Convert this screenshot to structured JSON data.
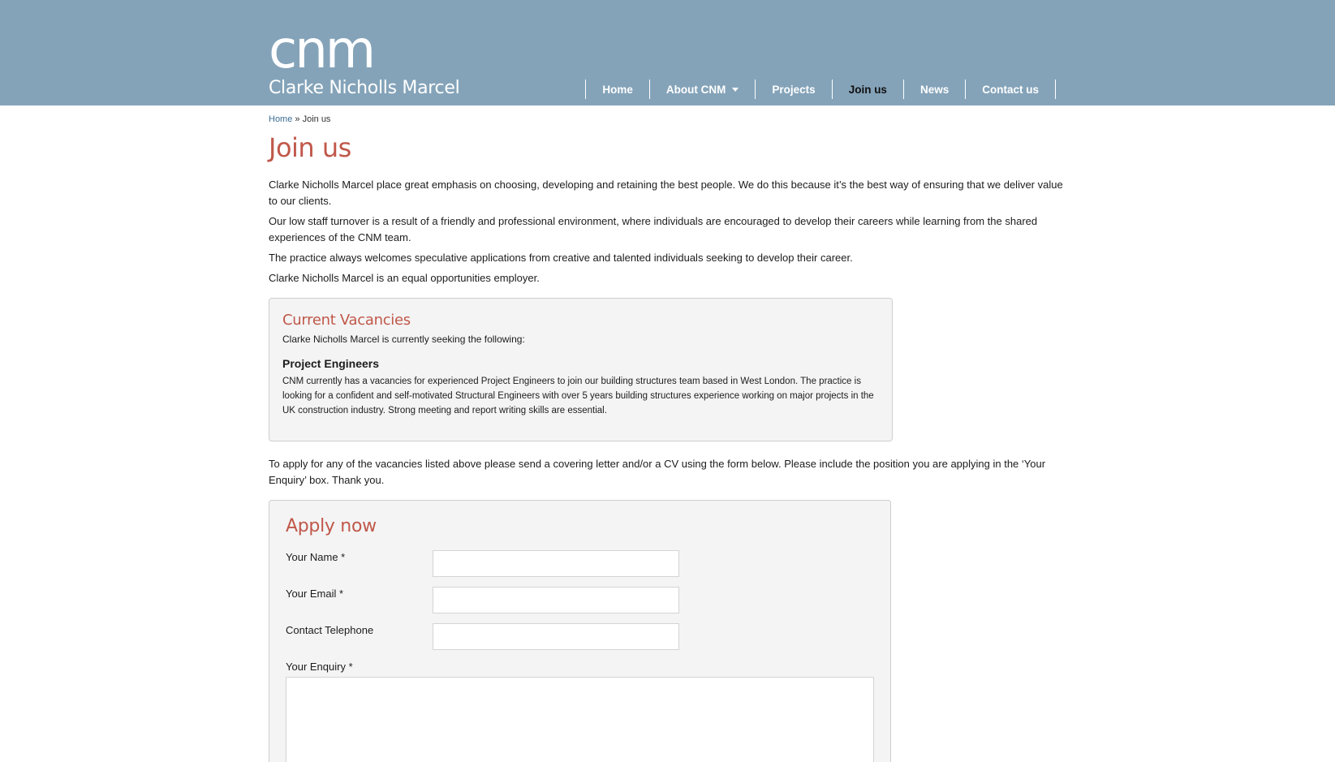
{
  "header": {
    "logo_mark": "cnm",
    "logo_name": "Clarke Nicholls Marcel"
  },
  "nav": {
    "items": [
      {
        "label": "Home"
      },
      {
        "label": "About CNM"
      },
      {
        "label": "Projects"
      },
      {
        "label": "Join us"
      },
      {
        "label": "News"
      },
      {
        "label": "Contact us"
      }
    ],
    "active": "Join us"
  },
  "breadcrumb": {
    "home": "Home",
    "separator": " » ",
    "current": "Join us"
  },
  "page": {
    "title": "Join us",
    "intro": [
      "Clarke Nicholls Marcel place great emphasis on choosing, developing and retaining the best people. We do this because it’s the best way of ensuring that we deliver value to our clients.",
      "Our low staff turnover is a result of a friendly and professional environment, where individuals are encouraged to develop their careers while learning from the shared expe­riences of the CNM team.",
      "The practice always welcomes speculative applications from creative and talented individuals seeking to develop their career.",
      "Clarke Nicholls Marcel is an equal opportunities employer."
    ]
  },
  "vacancies": {
    "heading": "Current Vacancies",
    "intro": "Clarke Nicholls Marcel is currently seeking the following:",
    "position_title": "Project Engineers",
    "position_description": "CNM currently has a vacancies for experienced Project Engineers to join our building structures team based in West London.  The practice is looking for a confident and self-motivated Structural Engineers with over 5 years building structures experience working on major projects in the UK construction industry.  Strong meeting and report writing skills are essential."
  },
  "apply_text": "To apply for any of the vacancies listed above please send a covering letter and/or a CV using the form below.  Please include the position you are applying in the ‘Your En­quiry’ box.  Thank you.",
  "form": {
    "heading": "Apply now",
    "name_label": "Your Name *",
    "name_value": "",
    "email_label": "Your Email *",
    "email_value": "",
    "phone_label": "Contact Telephone",
    "phone_value": "",
    "enquiry_label": "Your Enquiry *",
    "enquiry_value": ""
  },
  "colors": {
    "header_bg": "#84a3b9",
    "accent_red": "#c0584a",
    "link_blue": "#3d6f96",
    "panel_bg": "#f4f4f4"
  }
}
